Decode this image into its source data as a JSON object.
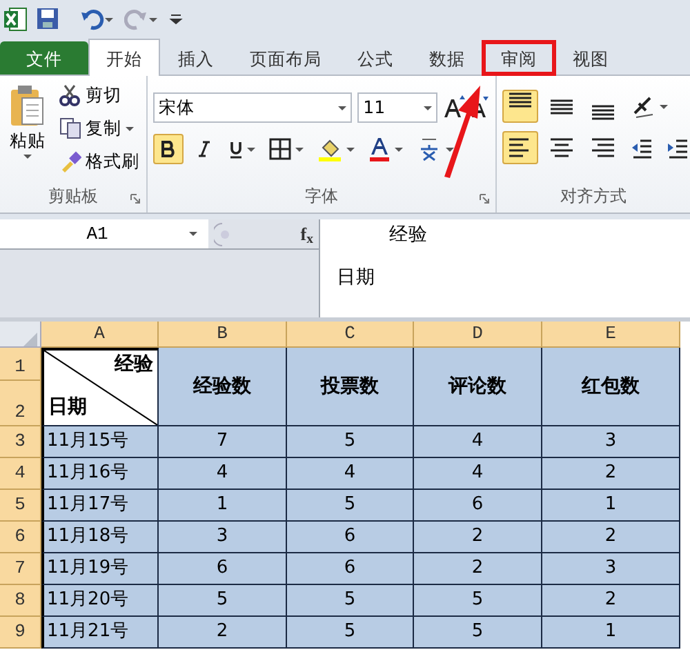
{
  "tabs": [
    {
      "label": "文件",
      "kind": "file",
      "selected": false,
      "callout": false
    },
    {
      "label": "开始",
      "kind": "tab",
      "selected": true,
      "callout": false
    },
    {
      "label": "插入",
      "kind": "tab",
      "selected": false,
      "callout": false
    },
    {
      "label": "页面布局",
      "kind": "tab",
      "selected": false,
      "callout": false
    },
    {
      "label": "公式",
      "kind": "tab",
      "selected": false,
      "callout": false
    },
    {
      "label": "数据",
      "kind": "tab",
      "selected": false,
      "callout": false
    },
    {
      "label": "审阅",
      "kind": "tab",
      "selected": false,
      "callout": true
    },
    {
      "label": "视图",
      "kind": "tab",
      "selected": false,
      "callout": false
    }
  ],
  "clipboard": {
    "paste": "粘贴",
    "cut": "剪切",
    "copy": "复制",
    "format_painter": "格式刷",
    "label": "剪贴板"
  },
  "font": {
    "name": "宋体",
    "size": "11",
    "bold": true,
    "italic": false,
    "underline": false,
    "label": "字体"
  },
  "alignment": {
    "top": true,
    "middle": false,
    "bottom": false,
    "left": true,
    "center": false,
    "right": false,
    "label": "对齐方式"
  },
  "formula_bar": {
    "name_box": "A1",
    "function_button": "f$_{x}$",
    "lines": [
      "经验",
      "日期"
    ]
  },
  "sheet": {
    "columns": [
      {
        "label": "A",
        "selected": true
      },
      {
        "label": "B",
        "selected": true
      },
      {
        "label": "C",
        "selected": true
      },
      {
        "label": "D",
        "selected": true
      },
      {
        "label": "E",
        "selected": true
      }
    ],
    "rows": [
      "1",
      "2",
      "3",
      "4",
      "5",
      "6",
      "7",
      "8",
      "9"
    ],
    "corner_cell": {
      "top_right": "经验",
      "bottom_left": "日期"
    },
    "headers": [
      "经验数",
      "投票数",
      "评论数",
      "红包数"
    ],
    "data": [
      [
        "11月15号",
        "7",
        "5",
        "4",
        "3"
      ],
      [
        "11月16号",
        "4",
        "4",
        "4",
        "2"
      ],
      [
        "11月17号",
        "1",
        "5",
        "6",
        "1"
      ],
      [
        "11月18号",
        "3",
        "6",
        "2",
        "2"
      ],
      [
        "11月19号",
        "6",
        "6",
        "2",
        "3"
      ],
      [
        "11月20号",
        "5",
        "5",
        "5",
        "2"
      ],
      [
        "11月21号",
        "2",
        "5",
        "5",
        "1"
      ]
    ],
    "selected": true
  }
}
